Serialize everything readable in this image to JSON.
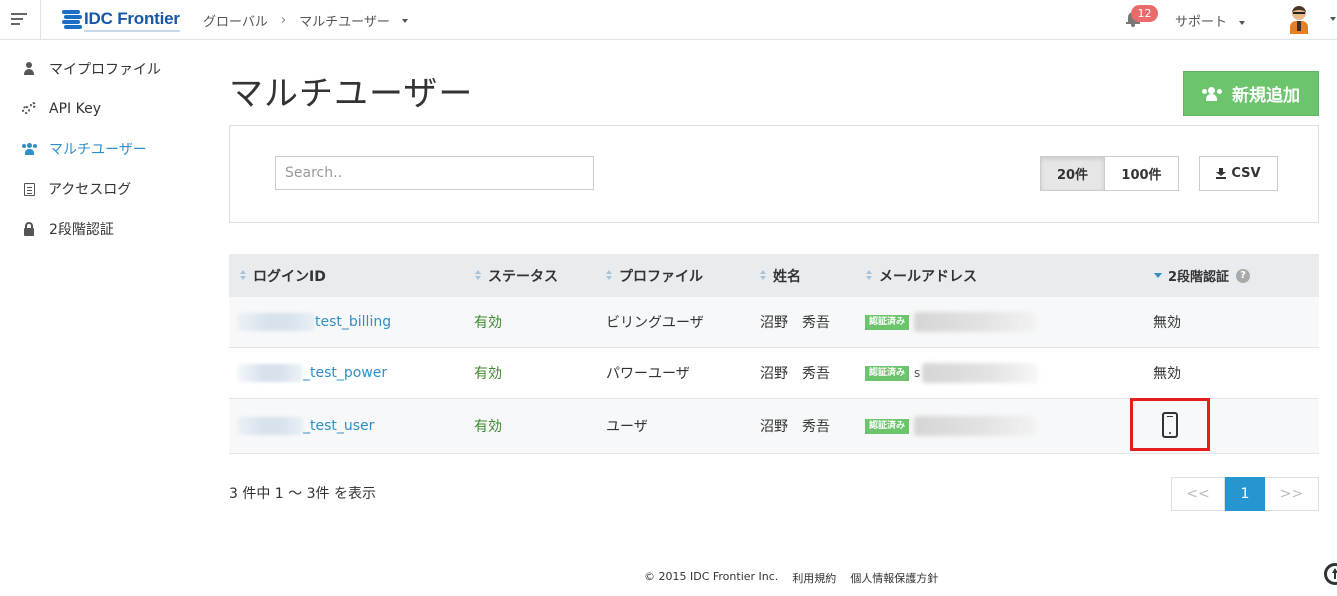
{
  "header": {
    "logo_text": "IDC Frontier",
    "breadcrumb": [
      "グローバル",
      "マルチユーザー"
    ],
    "breadcrumb_sep": "›",
    "notification_count": "12",
    "support_label": "サポート"
  },
  "sidebar": {
    "items": [
      {
        "label": "マイプロファイル",
        "icon": "user-icon",
        "active": false
      },
      {
        "label": "API Key",
        "icon": "gears-icon",
        "active": false
      },
      {
        "label": "マルチユーザー",
        "icon": "users-icon",
        "active": true
      },
      {
        "label": "アクセスログ",
        "icon": "file-icon",
        "active": false
      },
      {
        "label": "2段階認証",
        "icon": "lock-icon",
        "active": false
      }
    ]
  },
  "main": {
    "title": "マルチユーザー",
    "add_button": "新規追加",
    "search_placeholder": "Search..",
    "page_size_options": [
      "20件",
      "100件"
    ],
    "selected_page_size": "20件",
    "csv_button": "CSV"
  },
  "table": {
    "columns": [
      "ログインID",
      "ステータス",
      "プロファイル",
      "姓名",
      "メールアドレス",
      "2段階認証"
    ],
    "verified_badge": "認証済み",
    "rows": [
      {
        "login_suffix": "test_billing",
        "status": "有効",
        "profile": "ビリングユーザ",
        "name": "沼野　秀吾",
        "mfa": "無効"
      },
      {
        "login_suffix": "_test_power",
        "status": "有効",
        "profile": "パワーユーザ",
        "name": "沼野　秀吾",
        "email_visible": "s",
        "mfa": "無効"
      },
      {
        "login_suffix": "_test_user",
        "status": "有効",
        "profile": "ユーザ",
        "name": "沼野　秀吾",
        "mfa": "phone-icon"
      }
    ]
  },
  "pagination": {
    "summary": "3 件中 1 〜 3件 を表示",
    "prev": "<<",
    "current": "1",
    "next": ">>"
  },
  "footer": {
    "copyright": "© 2015 IDC Frontier Inc.",
    "terms": "利用規約",
    "privacy": "個人情報保護方針"
  },
  "colors": {
    "accent": "#2f8fc8",
    "add_button": "#6cc46d",
    "status_active": "#3c8a2e",
    "highlight_border": "#e41d1d",
    "badge": "#e96b6b"
  }
}
